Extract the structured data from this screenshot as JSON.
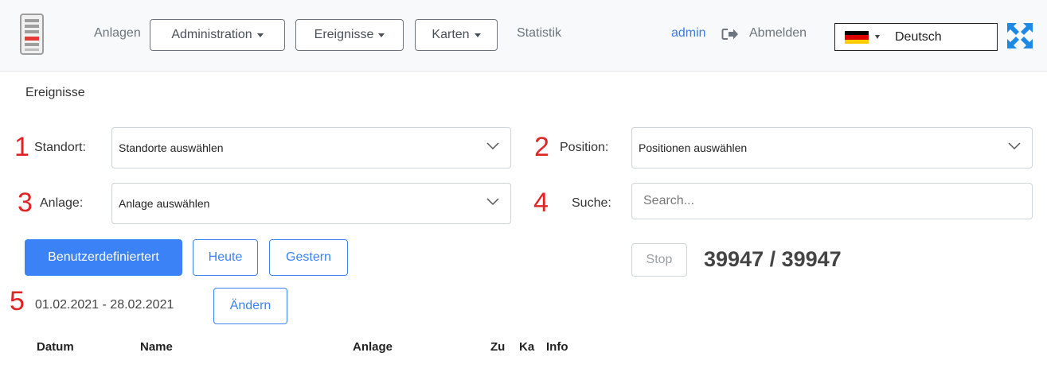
{
  "navbar": {
    "items": {
      "anlagen": "Anlagen",
      "administration": "Administration",
      "ereignisse": "Ereignisse",
      "karten": "Karten",
      "statistik": "Statistik"
    },
    "user": "admin",
    "logout": "Abmelden",
    "language": "Deutsch",
    "flag_colors": [
      "#000000",
      "#dd0000",
      "#ffcc00"
    ]
  },
  "page": {
    "title": "Ereignisse"
  },
  "annotations": [
    "1",
    "2",
    "3",
    "4",
    "5"
  ],
  "filters": {
    "standort_label": "Standort:",
    "standort_placeholder": "Standorte auswählen",
    "position_label": "Position:",
    "position_placeholder": "Positionen auswählen",
    "anlage_label": "Anlage:",
    "anlage_placeholder": "Anlage auswählen",
    "suche_label": "Suche:",
    "suche_placeholder": "Search..."
  },
  "buttons": {
    "custom": "Benutzerdefiniertert",
    "today": "Heute",
    "yesterday": "Gestern",
    "stop": "Stop",
    "change": "Ändern"
  },
  "counter": "39947 / 39947",
  "date_range": "01.02.2021 - 28.02.2021",
  "table": {
    "headers": [
      "Datum",
      "Name",
      "Anlage",
      "Zu",
      "Ka",
      "Info"
    ]
  },
  "colors": {
    "accent": "#3b82f6",
    "annotation": "#e02424",
    "expand_icon": "#1e88e5"
  }
}
